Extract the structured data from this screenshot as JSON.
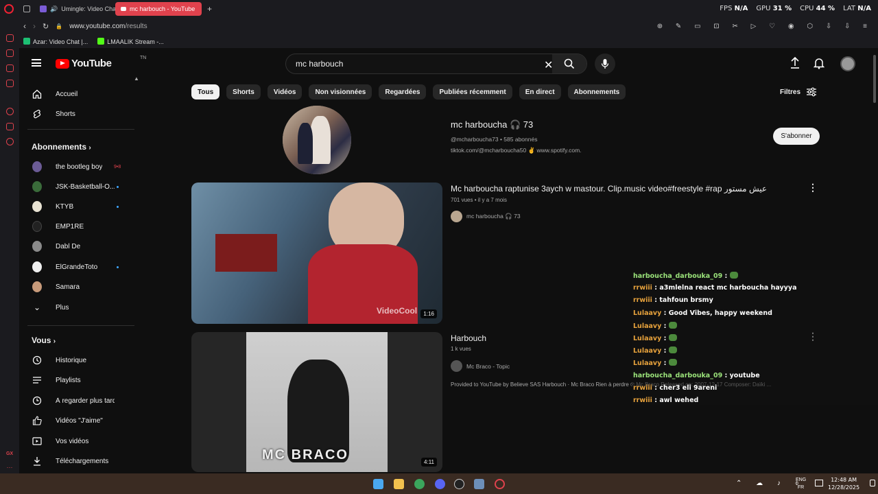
{
  "browser": {
    "tabs": [
      {
        "label": "Umingle: Video Chat w..."
      },
      {
        "label": "mc harbouch - YouTube"
      }
    ],
    "url_host": "www.youtube.com",
    "url_path": "/results",
    "bookmarks": [
      {
        "label": "Azar: Video Chat |..."
      },
      {
        "label": "LMAALIK Stream -..."
      }
    ],
    "hud": {
      "fps_label": "FPS",
      "fps_value": "N/A",
      "gpu_label": "GPU",
      "gpu_value": "31 %",
      "cpu_label": "CPU",
      "cpu_value": "44 %",
      "lat_label": "LAT",
      "lat_value": "N/A"
    },
    "strip_label": "GX"
  },
  "youtube": {
    "logo_text": "YouTube",
    "logo_suffix": "TN",
    "search_value": "mc harbouch",
    "sidebar": {
      "main": [
        {
          "label": "Accueil",
          "icon": "home-icon"
        },
        {
          "label": "Shorts",
          "icon": "shorts-icon"
        }
      ],
      "subs_heading": "Abonnements",
      "subs": [
        {
          "label": "the bootleg boy",
          "badge": "9•8",
          "color": "#6b5b95"
        },
        {
          "label": "JSK-Basketball-O...",
          "color": "#3a6b3a"
        },
        {
          "label": "KTYB",
          "color": "#e8e2d2"
        },
        {
          "label": "EMP1RE",
          "color": "#222222"
        },
        {
          "label": "Dabl De",
          "color": "#8a8a8a"
        },
        {
          "label": "ElGrandeToto",
          "color": "#efefef"
        },
        {
          "label": "Samara",
          "color": "#c79a7a"
        }
      ],
      "more_label": "Plus",
      "you_heading": "Vous",
      "you": [
        {
          "label": "Historique"
        },
        {
          "label": "Playlists"
        },
        {
          "label": "À regarder plus tard"
        },
        {
          "label": "Vidéos \"J'aime\""
        },
        {
          "label": "Vos vidéos"
        },
        {
          "label": "Téléchargements"
        }
      ]
    },
    "chips": [
      "Tous",
      "Shorts",
      "Vidéos",
      "Non visionnées",
      "Regardées",
      "Publiées récemment",
      "En direct",
      "Abonnements"
    ],
    "filters_label": "Filtres",
    "channel": {
      "title": "mc harboucha 🎧 73",
      "handle": "@mcharboucha73",
      "subs": "585 abonnés",
      "desc": "tiktok.com/@mcharboucha50 ✌ www.spotify.com.",
      "subscribe_label": "S'abonner"
    },
    "videos": [
      {
        "title": "Mc harboucha raptunise 3aych w mastour. Clip.music video#freestyle #rap عيش مستور",
        "views": "701 vues",
        "age": "il y a 7 mois",
        "channel": "mc harboucha 🎧 73",
        "duration": "1:16",
        "watermark": "VideoCool"
      },
      {
        "title": "Harbouch",
        "views": "1 k vues",
        "channel": "Mc Braco - Topic",
        "desc": "Provided to YouTube by Believe SAS Harbouch · Mc Braco Rien à perdre ℗ Mc Braco Released on: 2007-12-17 Composer: Daïki ...",
        "duration": "4:11",
        "cover_text": "MC BRACO"
      }
    ]
  },
  "chat": [
    {
      "user": "harboucha_darbouka_09",
      "text": " : ",
      "emote": true,
      "green": true
    },
    {
      "user": "rrwiii",
      "text": " : a3mlelna react mc harboucha hayyya"
    },
    {
      "user": "rrwiii",
      "text": " : tahfoun brsmy"
    },
    {
      "user": "Lulaavy",
      "text": " : Good Vibes, happy weekend"
    },
    {
      "user": "Lulaavy",
      "text": " : ",
      "emote": true
    },
    {
      "user": "Lulaavy",
      "text": " : ",
      "emote": true
    },
    {
      "user": "Lulaavy",
      "text": " : ",
      "emote": true
    },
    {
      "user": "Lulaavy",
      "text": " : ",
      "emote": true
    },
    {
      "user": "harboucha_darbouka_09",
      "text": " : youtube",
      "green": true
    },
    {
      "user": "rrwiii",
      "text": " : cher3 eli 9areni"
    },
    {
      "user": "rrwiii",
      "text": " : awl wehed"
    }
  ],
  "taskbar": {
    "lang_top": "ENG",
    "lang_bottom": "FR",
    "time": "12:48 AM",
    "date": "12/28/2025"
  }
}
